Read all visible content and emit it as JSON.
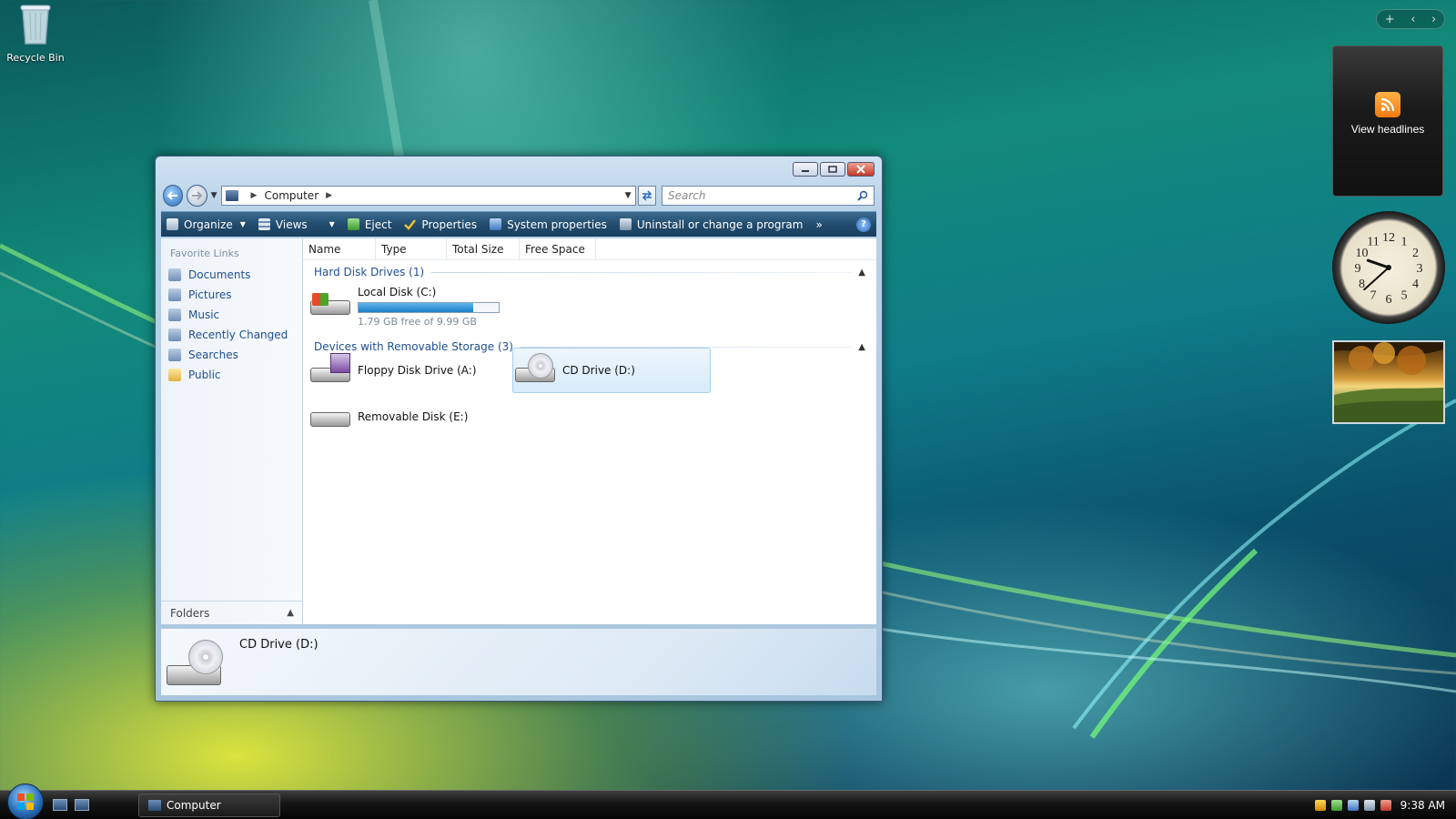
{
  "desktop": {
    "recycle_bin_label": "Recycle Bin"
  },
  "sidebar": {
    "rss_label": "View headlines",
    "clock": {
      "hour": 9,
      "minute": 38
    },
    "add_label": "+",
    "prev_label": "‹",
    "next_label": "›"
  },
  "window": {
    "address": {
      "location": "Computer"
    },
    "search_placeholder": "Search",
    "toolbar": {
      "organize": "Organize",
      "views": "Views",
      "eject": "Eject",
      "properties": "Properties",
      "system_properties": "System properties",
      "uninstall": "Uninstall or change a program",
      "more": "»",
      "help": "?"
    },
    "nav": {
      "heading": "Favorite Links",
      "items": [
        "Documents",
        "Pictures",
        "Music",
        "Recently Changed",
        "Searches",
        "Public"
      ],
      "folders_label": "Folders"
    },
    "columns": [
      "Name",
      "Type",
      "Total Size",
      "Free Space"
    ],
    "groups": {
      "hard_disk_title": "Hard Disk Drives (1)",
      "removable_title": "Devices with Removable Storage (3)"
    },
    "drives": {
      "local_c": {
        "name": "Local Disk (C:)",
        "space": "1.79 GB free of 9.99 GB",
        "used_fraction": 0.82
      },
      "floppy_a": {
        "name": "Floppy Disk Drive (A:)"
      },
      "cd_d": {
        "name": "CD Drive (D:)"
      },
      "removable_e": {
        "name": "Removable Disk (E:)"
      }
    },
    "details": {
      "name": "CD Drive (D:)"
    }
  },
  "taskbar": {
    "task_label": "Computer",
    "time": "9:38 AM"
  },
  "colors": {
    "accent": "#1e4f94",
    "toolbar": "#204a6c",
    "usage_bar": "#1d7fc7"
  }
}
